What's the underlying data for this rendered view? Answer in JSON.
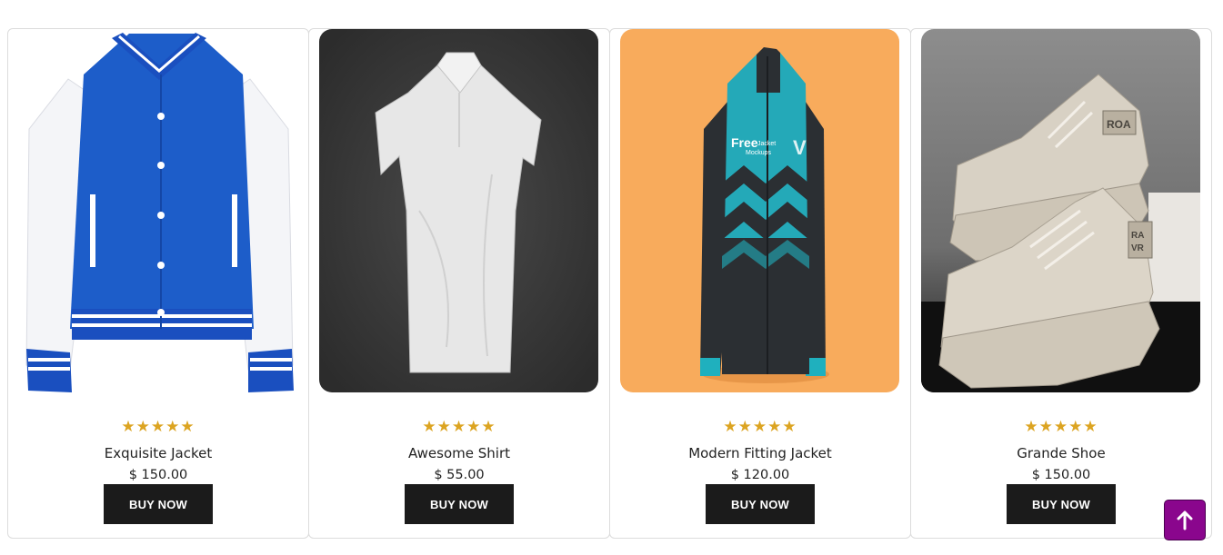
{
  "products": [
    {
      "name": "Exquisite Jacket",
      "price": "$ 150.00",
      "rating": 5,
      "stars": "★★★★★",
      "buy_label": "BUY NOW",
      "image": "blue-varsity-jacket"
    },
    {
      "name": "Awesome Shirt",
      "price": "$ 55.00",
      "rating": 5,
      "stars": "★★★★★",
      "buy_label": "BUY NOW",
      "image": "white-polo-shirt"
    },
    {
      "name": "Modern Fitting Jacket",
      "price": "$ 120.00",
      "rating": 5,
      "stars": "★★★★★",
      "buy_label": "BUY NOW",
      "image": "teal-track-jacket"
    },
    {
      "name": "Grande Shoe",
      "price": "$ 150.00",
      "rating": 5,
      "stars": "★★★★★",
      "buy_label": "BUY NOW",
      "image": "beige-chunky-sneakers"
    }
  ],
  "jacket_logo": {
    "brand": "Free",
    "sub1": "Jacket",
    "sub2": "Mockups",
    "mark": "V"
  },
  "shoe_tag": {
    "top": "ROA",
    "side1": "RA",
    "side2": "VR"
  },
  "scroll_top": {
    "icon": "arrow-up-icon"
  },
  "colors": {
    "accent": "#8a068d",
    "button": "#1b1b1b",
    "star": "#dca421"
  }
}
